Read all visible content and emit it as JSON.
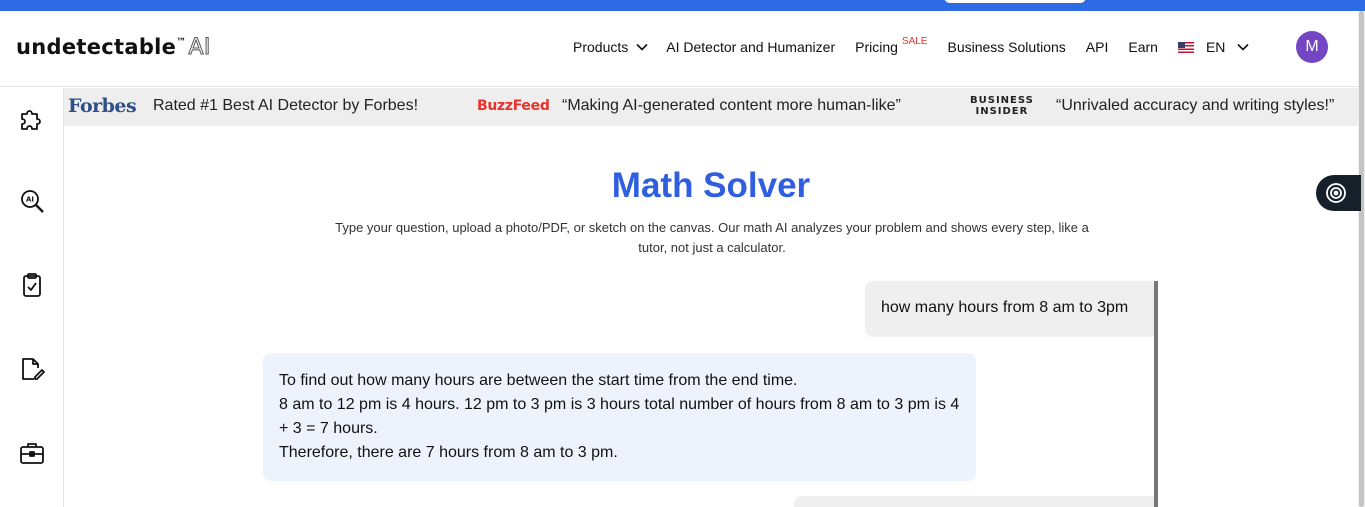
{
  "brand": {
    "logo_text": "undetectable",
    "logo_tm": "™",
    "logo_ai": "AI",
    "accent_color": "#2f5fe0",
    "top_strip_color": "#2d6be4"
  },
  "nav": {
    "products": "Products",
    "ai_detector": "AI Detector and Humanizer",
    "pricing": "Pricing",
    "pricing_badge": "SALE",
    "business": "Business Solutions",
    "api": "API",
    "earn": "Earn",
    "language": "EN",
    "avatar_initial": "M",
    "avatar_color": "#7446c4"
  },
  "sidebar": {
    "icons": [
      "puzzle-icon",
      "ai-search-icon",
      "clipboard-check-icon",
      "document-edit-icon",
      "briefcase-icon"
    ]
  },
  "banner": {
    "forbes_logo": "Forbes",
    "forbes_quote": "Rated #1 Best AI Detector by Forbes!",
    "buzzfeed_logo": "BuzzFeed",
    "buzzfeed_quote": "“Making AI-generated content more human-like”",
    "bi_logo_line1": "BUSINESS",
    "bi_logo_line2": "INSIDER",
    "bi_quote": "“Unrivaled accuracy and writing styles!”"
  },
  "main": {
    "title": "Math Solver",
    "subtitle": "Type your question, upload a photo/PDF, or sketch on the canvas. Our math AI analyzes your problem and shows every step, like a tutor, not just a calculator."
  },
  "chat": {
    "user_message": "how many hours from 8 am to 3pm",
    "ai_lines": [
      "To find out how many hours are between the start time from the end time.",
      "8 am to 12 pm is 4 hours. 12 pm to 3 pm is 3 hours total number of hours from 8 am to 3 pm is 4 + 3 = 7 hours.",
      "Therefore, there are 7 hours from 8 am to 3 pm."
    ]
  }
}
